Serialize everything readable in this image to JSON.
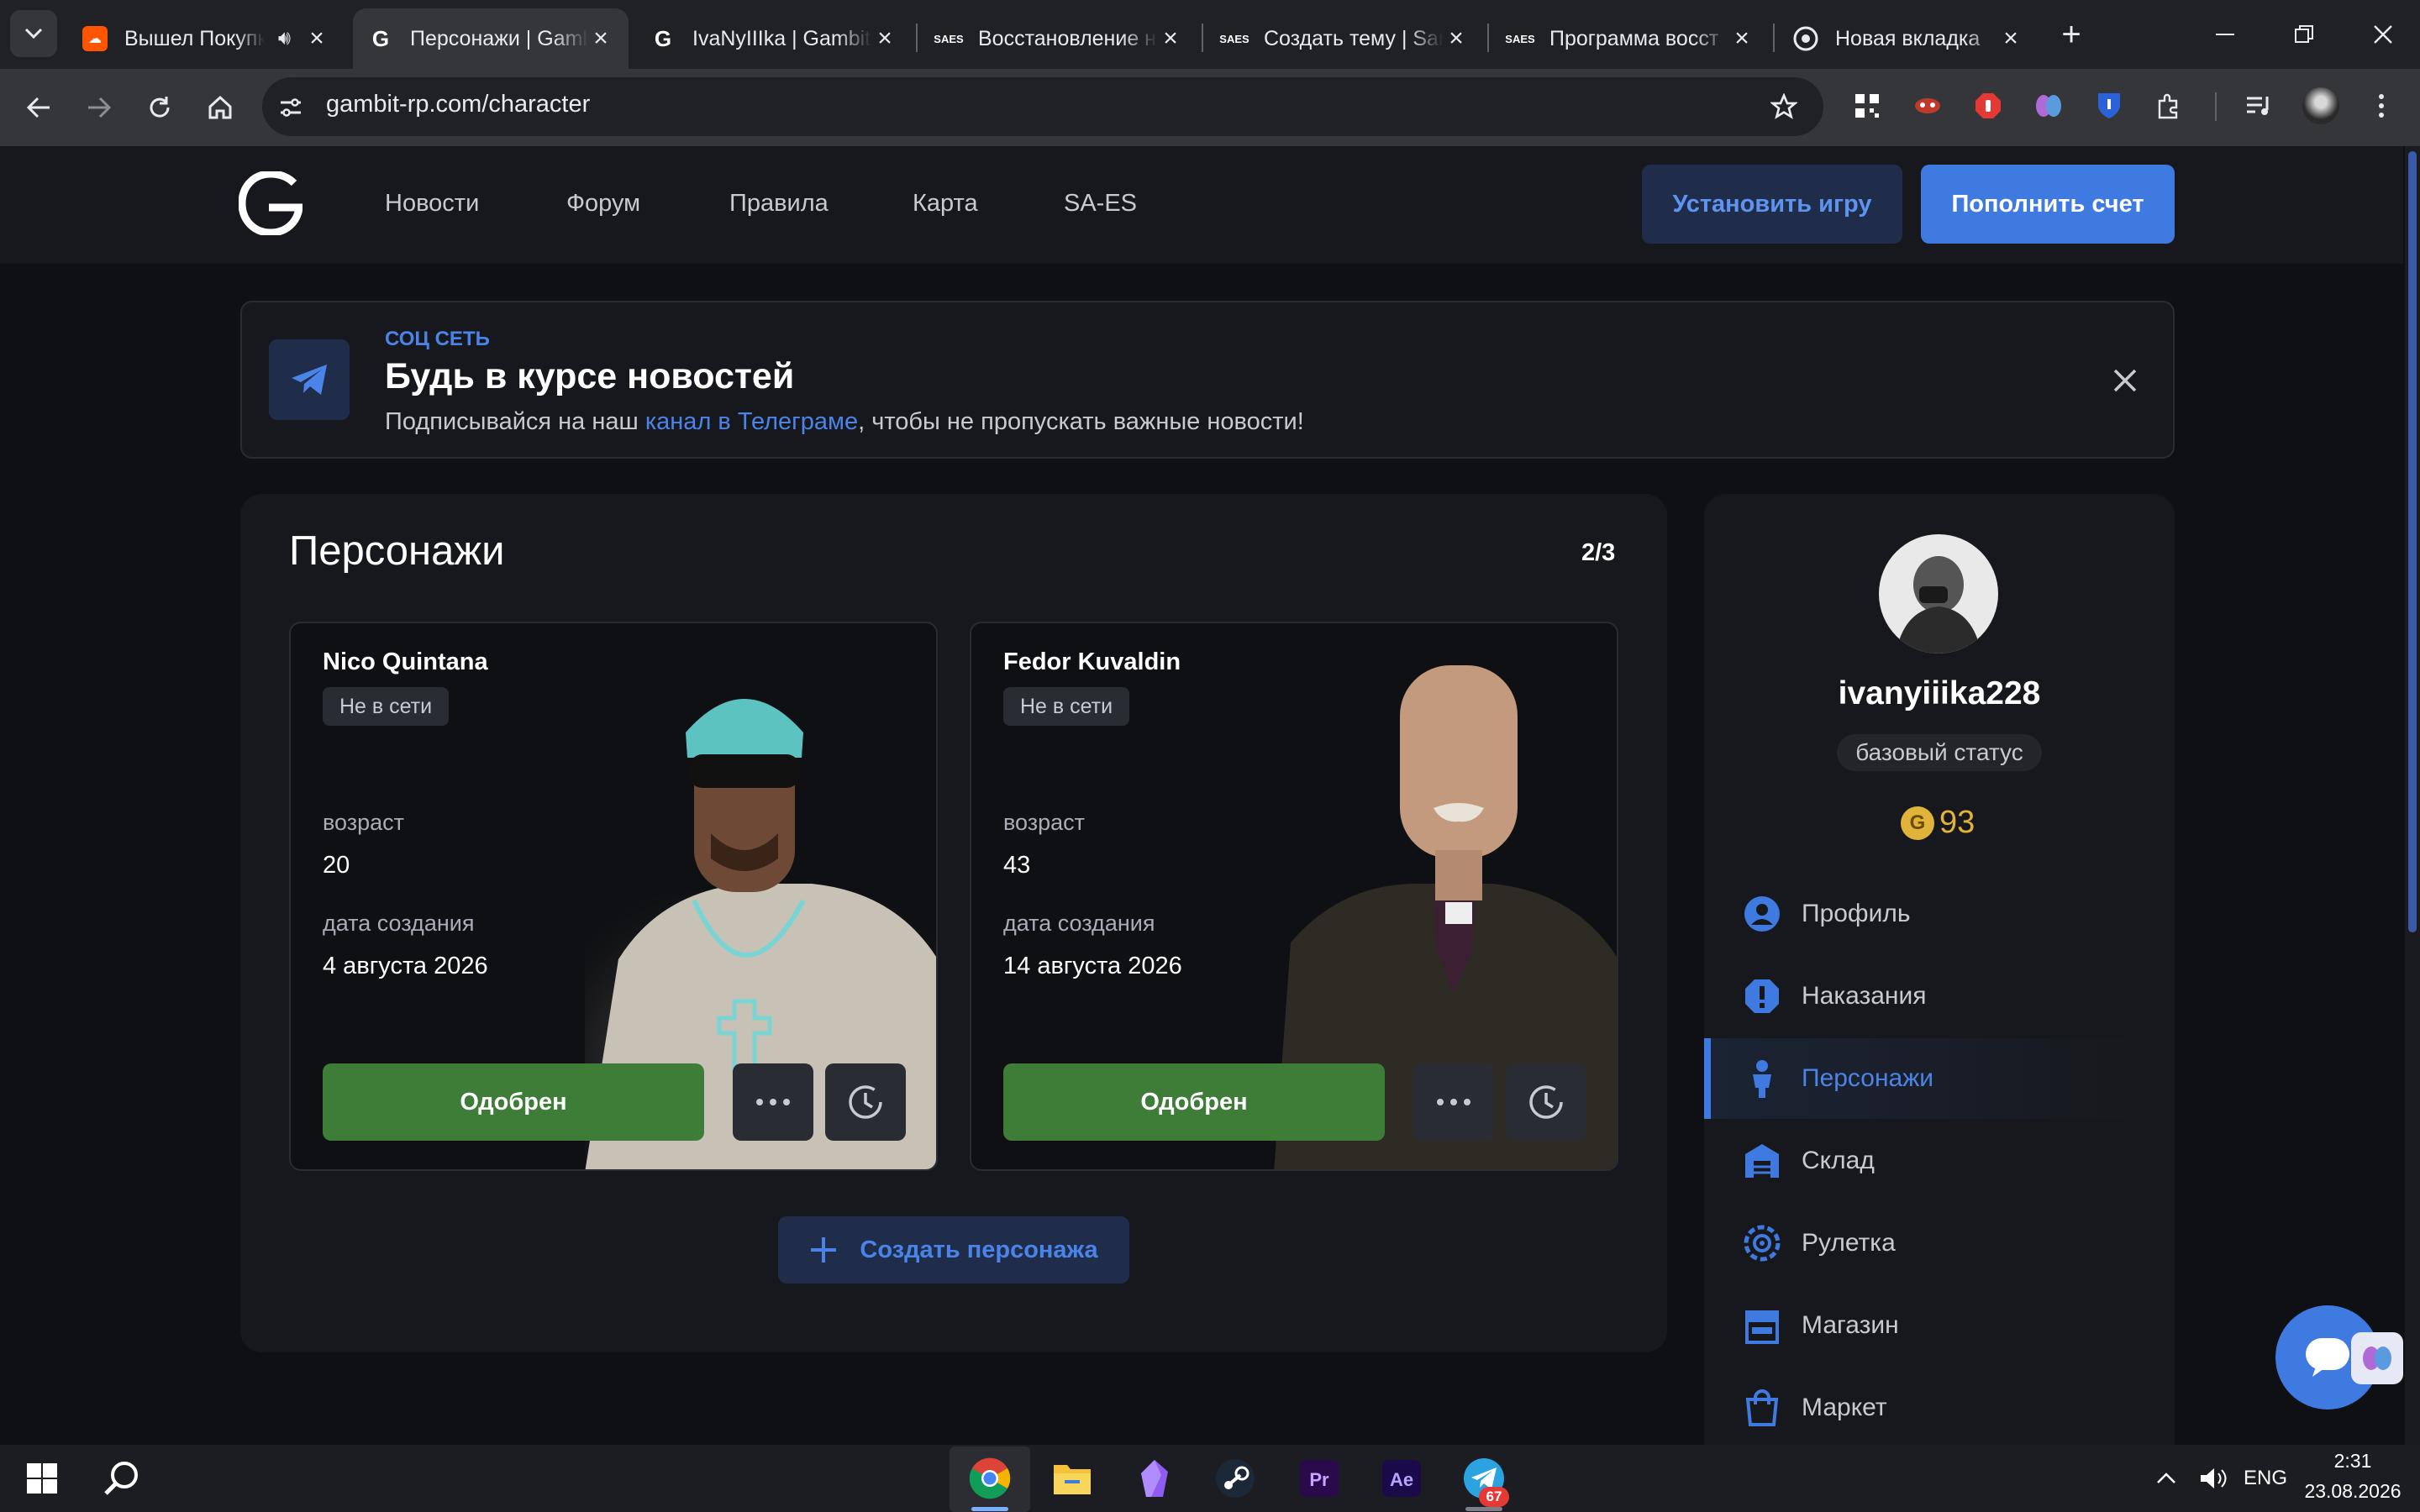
{
  "browser": {
    "tabs": [
      {
        "title": "Вышел Покупка",
        "favicon": "soundcloud-icon",
        "color": "#ff5500"
      },
      {
        "title": "Персонажи | Gambit",
        "favicon": "gambit-icon",
        "color": "#ffffff"
      },
      {
        "title": "IvaNyIIIka | Gambit",
        "favicon": "gambit-icon",
        "color": "#ffffff"
      },
      {
        "title": "Восстановление на",
        "favicon": "saes-icon",
        "color": "#ffffff"
      },
      {
        "title": "Создать тему | San",
        "favicon": "saes-icon",
        "color": "#ffffff"
      },
      {
        "title": "Программа восст",
        "favicon": "saes-icon",
        "color": "#ffffff"
      },
      {
        "title": "Новая вкладка",
        "favicon": "chrome-icon",
        "color": "#ffffff"
      }
    ],
    "url": "gambit-rp.com/character"
  },
  "site": {
    "nav": [
      "Новости",
      "Форум",
      "Правила",
      "Карта",
      "SA-ES"
    ],
    "install_label": "Установить игру",
    "topup_label": "Пополнить счет",
    "accent": "#3f7ae0"
  },
  "banner": {
    "tag": "СОЦ СЕТЬ",
    "title": "Будь в курсе новостей",
    "text_before": "Подписывайся на наш ",
    "link": "канал в Телеграме",
    "text_after": ", чтобы не пропускать важные новости!"
  },
  "characters": {
    "title": "Персонажи",
    "count": "2/3",
    "list": [
      {
        "name": "Nico Quintana",
        "status": "Не в сети",
        "age_label": "возраст",
        "age": "20",
        "created_label": "дата создания",
        "created": "4 августа 2026",
        "approve_label": "Одобрен"
      },
      {
        "name": "Fedor Kuvaldin",
        "status": "Не в сети",
        "age_label": "возраст",
        "age": "43",
        "created_label": "дата создания",
        "created": "14 августа 2026",
        "approve_label": "Одобрен"
      }
    ],
    "create_label": "Создать персонажа"
  },
  "profile": {
    "username": "ivanyiiika228",
    "status": "базовый статус",
    "coins": "93",
    "coin_letter": "G",
    "menu": [
      {
        "label": "Профиль",
        "icon": "user-icon"
      },
      {
        "label": "Наказания",
        "icon": "warning-icon"
      },
      {
        "label": "Персонажи",
        "icon": "person-icon",
        "active": true
      },
      {
        "label": "Склад",
        "icon": "warehouse-icon"
      },
      {
        "label": "Рулетка",
        "icon": "roulette-icon"
      },
      {
        "label": "Магазин",
        "icon": "store-icon"
      },
      {
        "label": "Маркет",
        "icon": "bag-icon"
      }
    ]
  },
  "taskbar": {
    "lang": "ENG",
    "time": "2:31",
    "date": "23.08.2026",
    "telegram_badge": "67"
  }
}
